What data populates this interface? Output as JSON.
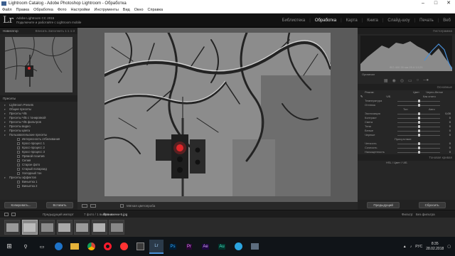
{
  "window": {
    "title": "Lightroom Catalog - Adobe Photoshop Lightroom - Обработка"
  },
  "menu": [
    "Файл",
    "Правка",
    "Обработка",
    "Фото",
    "Настройки",
    "Инструменты",
    "Вид",
    "Окно",
    "Справка"
  ],
  "identity": {
    "logo": "Lr",
    "line1": "Adobe Lightroom CC 2015",
    "line2": "Подключите и работайте с Lightroom mobile"
  },
  "modules": [
    {
      "label": "Библиотека",
      "active": false
    },
    {
      "label": "Обработка",
      "active": true
    },
    {
      "label": "Карта",
      "active": false
    },
    {
      "label": "Книга",
      "active": false
    },
    {
      "label": "Слайд-шоу",
      "active": false
    },
    {
      "label": "Печать",
      "active": false
    },
    {
      "label": "Веб",
      "active": false
    }
  ],
  "left": {
    "navigator": {
      "title": "Навигатор",
      "options": "Вписать  Заполнить  1:1  1:3"
    },
    "presets_title": "Пресеты",
    "presets": [
      {
        "label": "Lightroom Presets",
        "level": "top"
      },
      {
        "label": "Общие пресеты",
        "level": "top"
      },
      {
        "label": "Пресеты Ч/Б",
        "level": "top"
      },
      {
        "label": "Пресеты Ч/Б с тонировкой",
        "level": "top"
      },
      {
        "label": "Пресеты Ч/Б фильтров",
        "level": "top"
      },
      {
        "label": "Пресеты видео",
        "level": "top"
      },
      {
        "label": "Пресеты цвета",
        "level": "top"
      },
      {
        "label": "Пользовательские пресеты",
        "level": "top"
      },
      {
        "label": "Интересность отбеливания",
        "level": "item"
      },
      {
        "label": "Кросс-процесс 1",
        "level": "item"
      },
      {
        "label": "Кросс-процесс 2",
        "level": "item"
      },
      {
        "label": "Кросс-процесс 3",
        "level": "item"
      },
      {
        "label": "Прямой позитив",
        "level": "item"
      },
      {
        "label": "Сепия",
        "level": "item"
      },
      {
        "label": "Старое фото",
        "level": "item"
      },
      {
        "label": "Старый полароид",
        "level": "item"
      },
      {
        "label": "Холодный тон",
        "level": "item"
      },
      {
        "label": "Пресеты эффектов",
        "level": "top"
      },
      {
        "label": "Виньетка 1",
        "level": "item"
      },
      {
        "label": "Виньетка 2",
        "level": "item"
      }
    ],
    "copy_button": "Копировать...",
    "paste_button": "Вставить"
  },
  "toolbar": {
    "soft_proof": "Мягкая цветопроба"
  },
  "right": {
    "histogram_title": "Гистограмма",
    "histogram_readout": "ISO 400    35 мм    f/5.6    1/125",
    "original_label": "Оригинал",
    "basic_title": "Основные",
    "treatment_label": "Режим:",
    "treatment_color": "Цвет",
    "treatment_bw": "Черно-белое",
    "profile_label": "Ч/Б",
    "wb_label": "Баланс белого:",
    "wb_value": "Как снято",
    "tone_label": "Тон",
    "auto_label": "Авто",
    "presence_label": "Присутствие",
    "sliders1": [
      {
        "label": "Температура",
        "value": "",
        "pos": 0.5
      },
      {
        "label": "Оттенок",
        "value": "",
        "pos": 0.5
      }
    ],
    "sliders2": [
      {
        "label": "Экспозиция",
        "value": "0,00",
        "pos": 0.5
      },
      {
        "label": "Контраст",
        "value": "0",
        "pos": 0.5
      },
      {
        "label": "Света",
        "value": "0",
        "pos": 0.5
      },
      {
        "label": "Тени",
        "value": "0",
        "pos": 0.5
      },
      {
        "label": "Белые",
        "value": "0",
        "pos": 0.5
      },
      {
        "label": "Черные",
        "value": "0",
        "pos": 0.5
      }
    ],
    "sliders3": [
      {
        "label": "Четкость",
        "value": "0",
        "pos": 0.5
      },
      {
        "label": "Сочность",
        "value": "0",
        "pos": 0.5
      },
      {
        "label": "Насыщенность",
        "value": "0",
        "pos": 0.5
      }
    ],
    "tone_curve": "Тоновая кривая",
    "hsl_tabs": "HSL  /  Цвет  /  Ч/Б",
    "prev_button": "Предыдущий",
    "reset_button": "Сбросить"
  },
  "filmbar": {
    "source": "Предыдущий импорт",
    "count": "7 фото / 1 выбрано",
    "file": "/Без имени-5.jpg",
    "filter_label": "Фильтр:",
    "filter_value": "Без фильтра"
  },
  "filmstrip": {
    "thumb_count": 7,
    "selected_index": 1
  },
  "taskbar": {
    "lang": "РУС",
    "time": "8:35",
    "date": "28.02.2018"
  },
  "colors": {
    "accent": "#4a90d9",
    "signal_red": "#e0282a"
  }
}
